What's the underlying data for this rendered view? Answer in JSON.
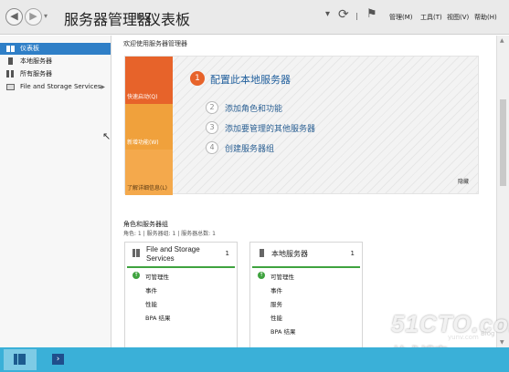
{
  "titlebar": {
    "app_name": "服务器管理器",
    "separator": "▸",
    "page": "仪表板",
    "menus": [
      "管理(M)",
      "工具(T)",
      "视图(V)",
      "帮助(H)"
    ]
  },
  "sidebar": {
    "items": [
      {
        "label": "仪表板",
        "icon": "dashboard-icon",
        "active": true
      },
      {
        "label": "本地服务器",
        "icon": "server-icon",
        "active": false
      },
      {
        "label": "所有服务器",
        "icon": "servers-icon",
        "active": false
      },
      {
        "label": "File and Storage Services",
        "icon": "storage-icon",
        "active": false,
        "has_arrow": true,
        "arrow": "▶"
      }
    ]
  },
  "main": {
    "welcome": "欢迎使用服务器管理器",
    "quick_start": {
      "tiles": [
        "快速启动(Q)",
        "新增功能(W)",
        "了解详细信息(L)"
      ],
      "steps": [
        {
          "num": "1",
          "text": "配置此本地服务器"
        },
        {
          "num": "2",
          "text": "添加角色和功能"
        },
        {
          "num": "3",
          "text": "添加要管理的其他服务器"
        },
        {
          "num": "4",
          "text": "创建服务器组"
        }
      ],
      "hide": "隐藏"
    },
    "roles": {
      "title": "角色和服务器组",
      "subtitle": "角色: 1 | 服务器组: 1 | 服务器总数: 1",
      "cards": [
        {
          "title": "File and Storage Services",
          "count": "1",
          "rows": [
            "可管理性",
            "事件",
            "性能",
            "BPA 结果"
          ]
        },
        {
          "title": "本地服务器",
          "count": "1",
          "rows": [
            "可管理性",
            "事件",
            "服务",
            "性能",
            "BPA 结果"
          ]
        }
      ]
    }
  },
  "watermark": {
    "brand": "51CTO.com",
    "chinese": "技术博客",
    "blog": "Blog",
    "url": "yunv.com"
  },
  "colors": {
    "accent": "#2f7fc7",
    "quick_start_orange": "#e7632a",
    "status_green": "#3fa33f",
    "taskbar": "#3ab0d8"
  }
}
